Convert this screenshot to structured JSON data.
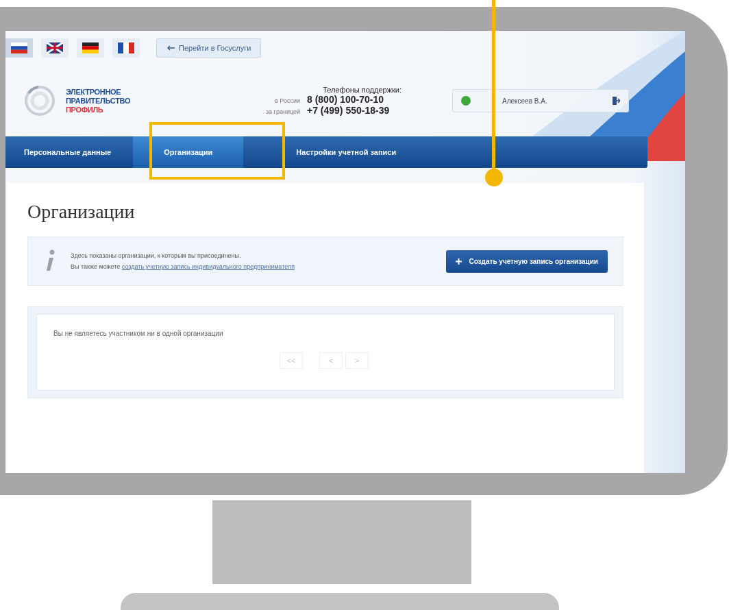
{
  "top_bar": {
    "back_button": "Перейти в Госуслуги"
  },
  "logo": {
    "lines": [
      {
        "text": "ЭЛЕКТРОННОЕ",
        "color": "#1f4e96"
      },
      {
        "text": "ПРАВИТЕЛЬСТВО",
        "color": "#1f4e96"
      },
      {
        "text": "ПРОФИЛЬ",
        "color": "#d9303a"
      }
    ]
  },
  "support": {
    "title": "Телефоны поддержки:",
    "phones": [
      {
        "label": "в России",
        "number": "8 (800) 100-70-10"
      },
      {
        "label": "за границей",
        "number": "+7 (499) 550-18-39"
      }
    ]
  },
  "user": {
    "name": "Алексеев В.А.",
    "verified": true
  },
  "tabs": [
    {
      "label": "Персональные данные",
      "selected": false
    },
    {
      "label": "Организации",
      "selected": true
    },
    {
      "label": "Настройки учетной записи",
      "selected": false
    }
  ],
  "page": {
    "title": "Организации",
    "info_lines": [
      "Здесь показаны организации, к которым вы присоединены.",
      "Вы также можете"
    ],
    "info_link": "создать учетную запись индивидуального предпринимателя",
    "create_button": "Создать учетную запись организации"
  },
  "list": {
    "empty_text": "Вы не являетесь участником ни в одной организации",
    "pagination": [
      {
        "label": "<<",
        "disabled": true
      },
      {
        "label": "<",
        "disabled": true
      },
      {
        "label": ">",
        "disabled": true
      }
    ]
  }
}
